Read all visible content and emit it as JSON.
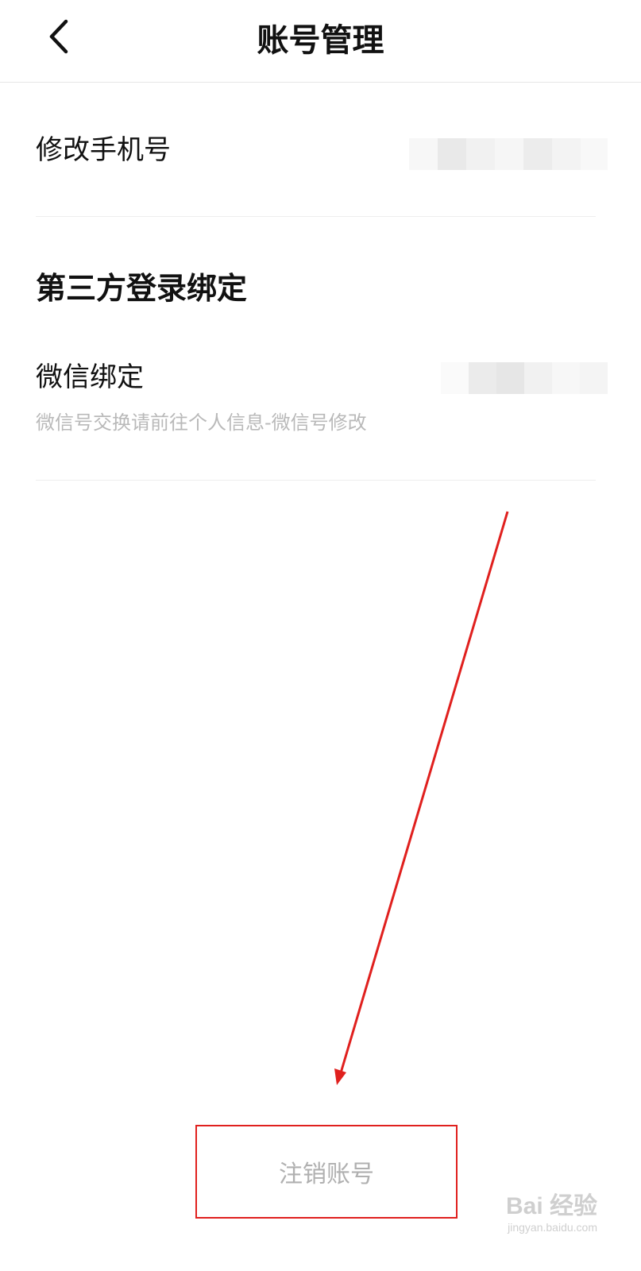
{
  "header": {
    "title": "账号管理",
    "back_icon": "chevron-left-icon"
  },
  "phone_row": {
    "label": "修改手机号",
    "value_state": "pixelated"
  },
  "section": {
    "title": "第三方登录绑定"
  },
  "wechat_row": {
    "label": "微信绑定",
    "hint": "微信号交换请前往个人信息-微信号修改",
    "value_state": "pixelated"
  },
  "footer": {
    "deactivate_label": "注销账号"
  },
  "annotation": {
    "color": "#e0201e",
    "points_to": "deactivate-button"
  },
  "watermark": {
    "brand": "Bai 经验",
    "url": "jingyan.baidu.com"
  },
  "colors": {
    "text_primary": "#111111",
    "text_hint": "#b9b9b9",
    "divider": "#eeeeee",
    "accent_red": "#e0201e"
  }
}
